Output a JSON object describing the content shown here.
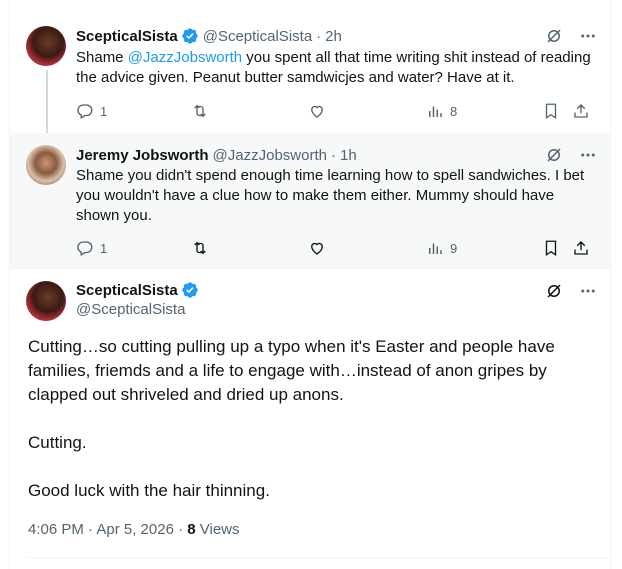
{
  "tweets": [
    {
      "name": "ScepticalSista",
      "handle": "@ScepticalSista",
      "dot": "·",
      "time": "2h",
      "text_pre": "Shame ",
      "mention": "@JazzJobsworth",
      "text_post": " you spent all that time writing shit instead of reading the advice given. Peanut butter samdwicjes and water? Have at it.",
      "replies": "1",
      "retweets": "",
      "likes": "",
      "views": "8"
    },
    {
      "name": "Jeremy Jobsworth",
      "handle": "@JazzJobsworth",
      "dot": "·",
      "time": "1h",
      "text": "Shame you didn't spend enough time learning how to spell sandwiches. I bet you wouldn't have a clue how to make them either. Mummy should have shown you.",
      "replies": "1",
      "retweets": "",
      "likes": "",
      "views": "9"
    }
  ],
  "main_tweet": {
    "name": "ScepticalSista",
    "handle": "@ScepticalSista",
    "paragraphs": [
      "Cutting…so cutting pulling up a typo when it's Easter and people have families, friemds and a life to engage with…instead of anon gripes by clapped out shriveled and dried up anons.",
      "Cutting.",
      "Good luck with the hair thinning."
    ],
    "timestamp": "4:06 PM · Apr 5, 2026 · ",
    "views_count": "8",
    "views_label": " Views"
  },
  "icons": {
    "verified": "verified-badge-icon",
    "grok": "grok-icon",
    "more": "more-icon",
    "reply": "reply-icon",
    "retweet": "retweet-icon",
    "like": "like-icon",
    "views": "views-icon",
    "bookmark": "bookmark-icon",
    "share": "share-icon"
  },
  "colors": {
    "link": "#1d9bf0",
    "verified": "#1d9bf0",
    "secondary_text": "#536471",
    "text": "#0f1419"
  }
}
